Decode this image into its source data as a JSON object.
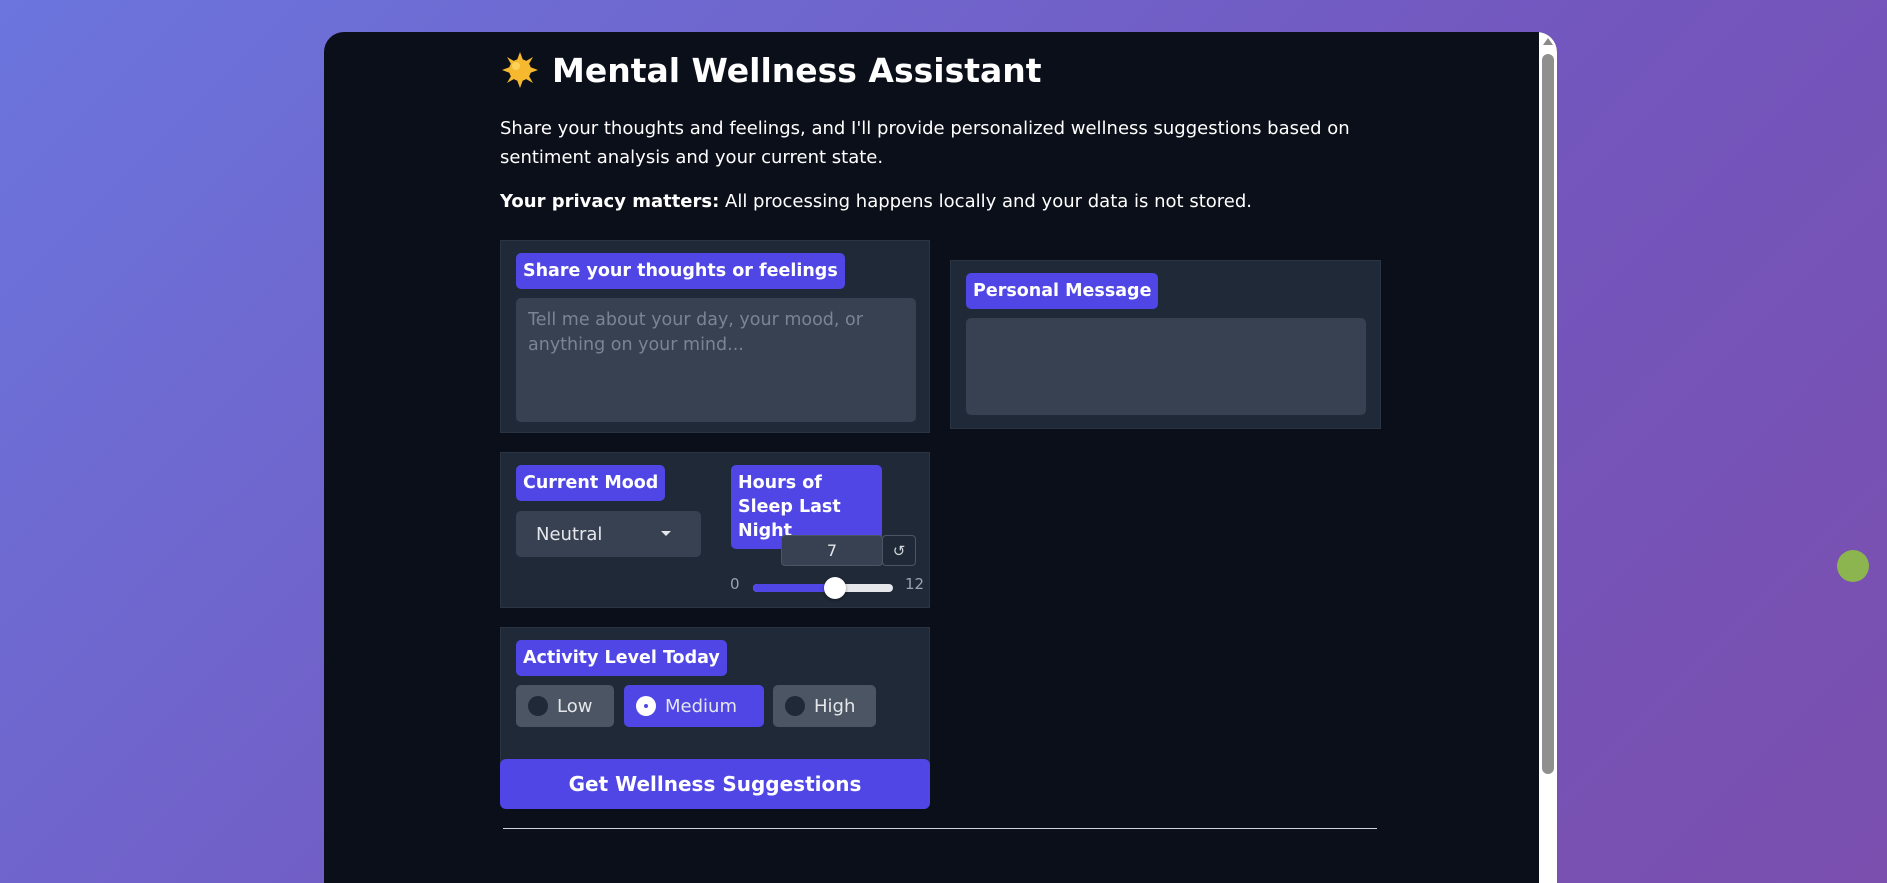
{
  "app": {
    "title": "Mental Wellness Assistant",
    "description": "Share your thoughts and feelings, and I'll provide personalized wellness suggestions based on sentiment analysis and your current state.",
    "privacy_bold": "Your privacy matters:",
    "privacy_text": " All processing happens locally and your data is not stored."
  },
  "thoughts": {
    "label": "Share your thoughts or feelings",
    "placeholder": "Tell me about your day, your mood, or anything on your mind...",
    "value": ""
  },
  "personal_message": {
    "label": "Personal Message",
    "value": ""
  },
  "mood": {
    "label": "Current Mood",
    "selected": "Neutral"
  },
  "sleep": {
    "label": "Hours of Sleep Last Night",
    "value": "7",
    "min": "0",
    "max": "12",
    "reset_icon": "↺",
    "level_fraction": 0.583
  },
  "activity": {
    "label": "Activity Level Today",
    "options": [
      "Low",
      "Medium",
      "High"
    ],
    "selected": "Medium"
  },
  "submit": {
    "label": "Get Wellness Suggestions"
  },
  "icons": {
    "title_icon": "sun-icon",
    "dropdown": "chevron-down-icon",
    "reset": "reset-icon"
  },
  "colors": {
    "accent": "#4f46e5",
    "panel_bg": "#0b0f19",
    "card_bg": "#1f2937"
  }
}
